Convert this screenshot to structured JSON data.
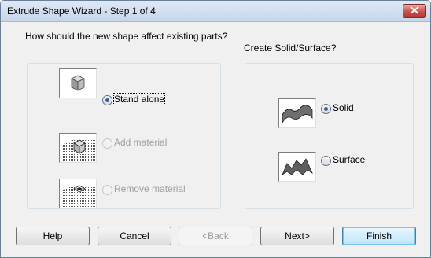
{
  "window": {
    "title": "Extrude Shape Wizard - Step 1 of 4"
  },
  "left_panel": {
    "question": "How should the new shape affect existing parts?",
    "options": [
      {
        "label": "Stand alone",
        "selected": true,
        "enabled": true
      },
      {
        "label": "Add material",
        "selected": false,
        "enabled": false
      },
      {
        "label": "Remove material",
        "selected": false,
        "enabled": false
      }
    ]
  },
  "right_panel": {
    "question": "Create Solid/Surface?",
    "options": [
      {
        "label": "Solid",
        "selected": true,
        "enabled": true
      },
      {
        "label": "Surface",
        "selected": false,
        "enabled": true
      }
    ]
  },
  "buttons": {
    "help": "Help",
    "cancel": "Cancel",
    "back": "<Back",
    "next": "Next>",
    "finish": "Finish"
  },
  "colors": {
    "selected_dot": "#2e5fa6",
    "disabled_text": "#a0a0a0",
    "titlebar": "#c6d6ea"
  }
}
